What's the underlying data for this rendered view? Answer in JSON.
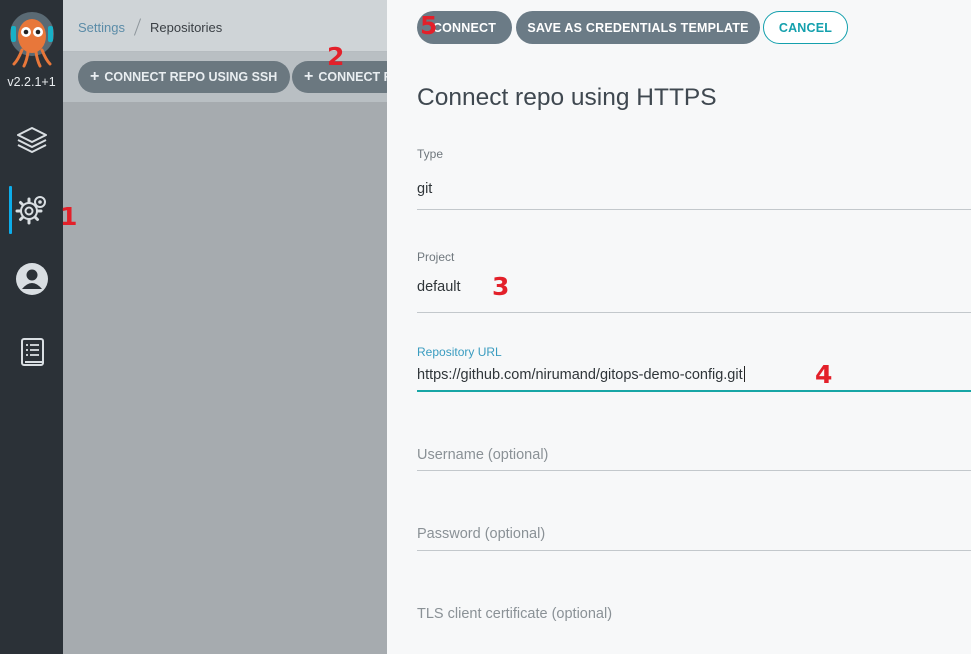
{
  "sidebar": {
    "version": "v2.2.1+1",
    "items": [
      {
        "icon": "layers-icon"
      },
      {
        "icon": "settings-gear-icon",
        "active": true
      },
      {
        "icon": "user-icon"
      },
      {
        "icon": "docs-icon"
      }
    ]
  },
  "breadcrumb": {
    "settings": "Settings",
    "current": "Repositories"
  },
  "toolbar": {
    "connect_ssh": "CONNECT REPO USING SSH",
    "connect_https": "CONNECT REPO USING HTTPS"
  },
  "panel": {
    "connect": "CONNECT",
    "save_template": "SAVE AS CREDENTIALS TEMPLATE",
    "cancel": "CANCEL",
    "title": "Connect repo using HTTPS",
    "type_label": "Type",
    "type_value": "git",
    "project_label": "Project",
    "project_value": "default",
    "url_label": "Repository URL",
    "url_value": "https://github.com/nirumand/gitops-demo-config.git",
    "username_placeholder": "Username (optional)",
    "password_placeholder": "Password (optional)",
    "tls_placeholder": "TLS client certificate (optional)"
  },
  "annotations": {
    "a1": "1",
    "a2": "2",
    "a3": "3",
    "a4": "4",
    "a5": "5"
  },
  "colors": {
    "accent": "#14a0ad",
    "annotation": "#e3202a",
    "sidebar": "#2b3137"
  }
}
